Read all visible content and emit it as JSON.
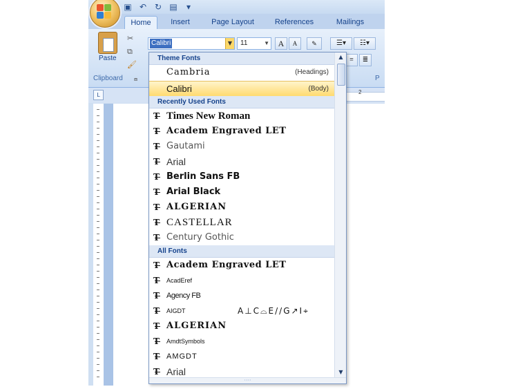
{
  "window": {
    "qat_icons": [
      "save-icon",
      "undo-icon",
      "redo-icon",
      "print-preview-icon",
      "customize-icon"
    ]
  },
  "tabs": [
    {
      "label": "Home",
      "active": true
    },
    {
      "label": "Insert",
      "active": false
    },
    {
      "label": "Page Layout",
      "active": false
    },
    {
      "label": "References",
      "active": false
    },
    {
      "label": "Mailings",
      "active": false
    }
  ],
  "ribbon": {
    "paste_label": "Paste",
    "clipboard_label": "Clipboard",
    "font_name": "Calibri",
    "font_size": "11",
    "grow_font": "A",
    "shrink_font": "A",
    "paragraph_label": "P"
  },
  "ruler": {
    "number": "2"
  },
  "font_dropdown": {
    "sections": {
      "theme": "Theme Fonts",
      "recent": "Recently Used Fonts",
      "all": "All Fonts"
    },
    "theme_fonts": [
      {
        "name": "Cambria",
        "tag": "(Headings)",
        "selected": false
      },
      {
        "name": "Calibri",
        "tag": "(Body)",
        "selected": true
      }
    ],
    "recent_fonts": [
      "Times New Roman",
      "Academ Engraved LET",
      "Gautami",
      "Arial",
      "Berlin Sans FB",
      "Arial Black",
      "ALGERIAN",
      "CASTELLAR",
      "Century Gothic"
    ],
    "all_fonts": [
      {
        "name": "Academ Engraved LET",
        "sample": ""
      },
      {
        "name": "AcadEref",
        "sample": ""
      },
      {
        "name": "Agency FB",
        "sample": ""
      },
      {
        "name": "AIGDT",
        "sample": "A⊥C⌓E//G↗I⌖"
      },
      {
        "name": "ALGERIAN",
        "sample": ""
      },
      {
        "name": "AmdtSymbols",
        "sample": ""
      },
      {
        "name": "AMGDT",
        "sample": ""
      },
      {
        "name": "Arial",
        "sample": ""
      }
    ]
  },
  "colors": {
    "ribbon_text": "#15428b",
    "selection": "#ffd96b",
    "section_header": "#dde7f5"
  }
}
